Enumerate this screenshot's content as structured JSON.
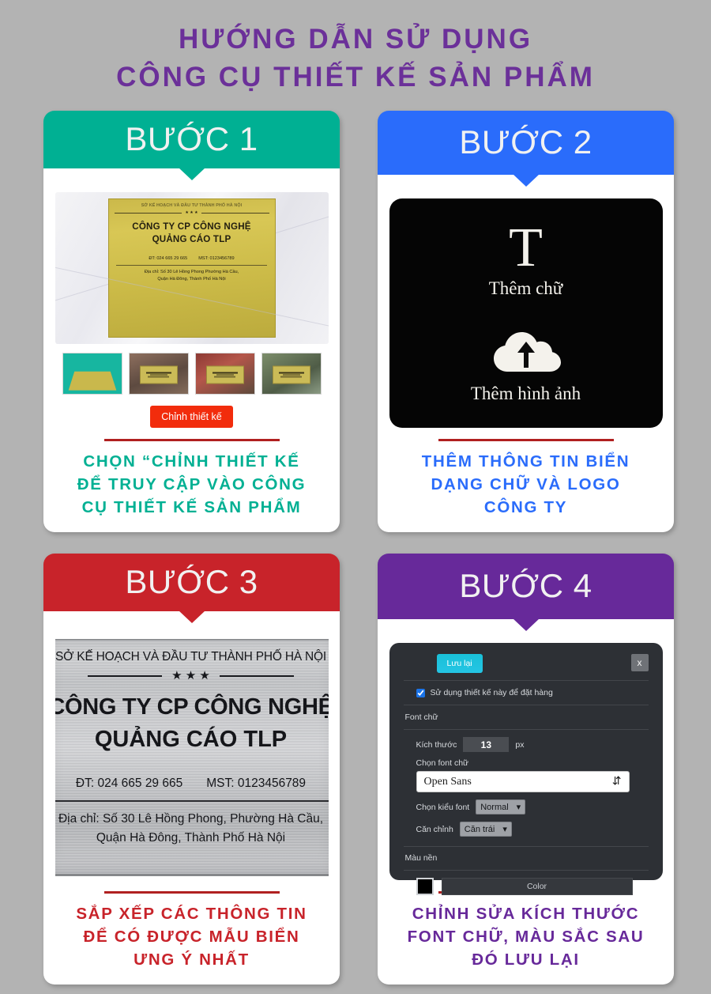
{
  "page": {
    "background_color": "#b3b3b3",
    "title_color": "#6b3099",
    "title_line1": "HƯỚNG DẪN SỬ DỤNG",
    "title_line2": "CÔNG CỤ THIẾT KẾ SẢN PHẨM"
  },
  "cards": [
    {
      "step_label": "BƯỚC 1",
      "header_color": "#00b093",
      "caption_color": "#00b093",
      "caption_line1": "CHỌN “CHỈNH THIẾT KẾ",
      "caption_line2": "ĐỂ TRUY CẬP VÀO CÔNG",
      "caption_line3": "CỤ THIẾT KẾ SẢN PHẨM",
      "plaque": {
        "dept": "SỞ KẾ HOẠCH VÀ ĐẦU TƯ THÀNH PHỐ HÀ NỘI",
        "stars": "★ ★ ★",
        "name_line1": "CÔNG TY CP CÔNG NGHỆ",
        "name_line2": "QUẢNG CÁO TLP",
        "phone": "ĐT: 024 665 29 665",
        "tax": "MST: 0123456789",
        "address_line1": "Địa chỉ: Số 30 Lê Hồng Phong  Phường Hà Cầu,",
        "address_line2": "Quận Hà Đông, Thành Phố Hà Nội"
      },
      "thumbnails": [
        "thumbnail-1",
        "thumbnail-2",
        "thumbnail-3",
        "thumbnail-4"
      ],
      "edit_button_label": "Chỉnh thiết kế",
      "edit_button_color": "#f22c0c"
    },
    {
      "step_label": "BƯỚC 2",
      "header_color": "#2a6cfb",
      "caption_color": "#2a6cfb",
      "caption_line1": "THÊM THÔNG TIN BIỂN",
      "caption_line2": "DẠNG CHỮ VÀ LOGO",
      "caption_line3": "CÔNG TY",
      "panel": {
        "text_glyph": "T",
        "add_text_label": "Thêm chữ",
        "add_image_label": "Thêm hình ảnh",
        "panel_color": "#050505"
      }
    },
    {
      "step_label": "BƯỚC 3",
      "header_color": "#c8232a",
      "caption_color": "#c8232a",
      "caption_line1": "SẮP XẾP CÁC THÔNG TIN",
      "caption_line2": "ĐỂ CÓ ĐƯỢC MẪU BIỂN",
      "caption_line3": "ƯNG Ý NHẤT",
      "plaque": {
        "dept": "SỞ KẾ HOẠCH VÀ ĐẦU TƯ THÀNH PHỐ HÀ NỘI",
        "stars": "★ ★ ★",
        "name_line1": "CÔNG TY CP CÔNG NGHỆ",
        "name_line2": "QUẢNG CÁO TLP",
        "phone": "ĐT: 024 665 29 665",
        "tax": "MST: 0123456789",
        "address_line1": "Địa chỉ: Số 30 Lê Hồng Phong, Phường Hà Cầu,",
        "address_line2": "Quận Hà Đông, Thành Phố Hà Nội"
      }
    },
    {
      "step_label": "BƯỚC 4",
      "header_color": "#67299a",
      "caption_color": "#67299a",
      "caption_line1": "CHỈNH SỬA KÍCH THƯỚC",
      "caption_line2": "FONT CHỮ, MÀU SẮC SAU",
      "caption_line3": "ĐÓ LƯU LẠI",
      "dialog": {
        "save_label": "Lưu lại",
        "close_label": "x",
        "checkbox_label": "Sử dụng thiết kế này để đặt hàng",
        "checkbox_checked": true,
        "font_section_label": "Font chữ",
        "size_label": "Kích thước",
        "size_value": "13",
        "size_unit": "px",
        "choose_font_label": "Chọn font chữ",
        "font_value": "Open Sans",
        "font_style_label": "Chọn kiểu font",
        "font_style_value": "Normal",
        "align_label": "Căn chỉnh",
        "align_value": "Căn trái",
        "bg_section_label": "Màu nền",
        "color_button_label": "Color",
        "color_swatch": "#000000",
        "save_button_color": "#1fc2dd"
      }
    }
  ]
}
